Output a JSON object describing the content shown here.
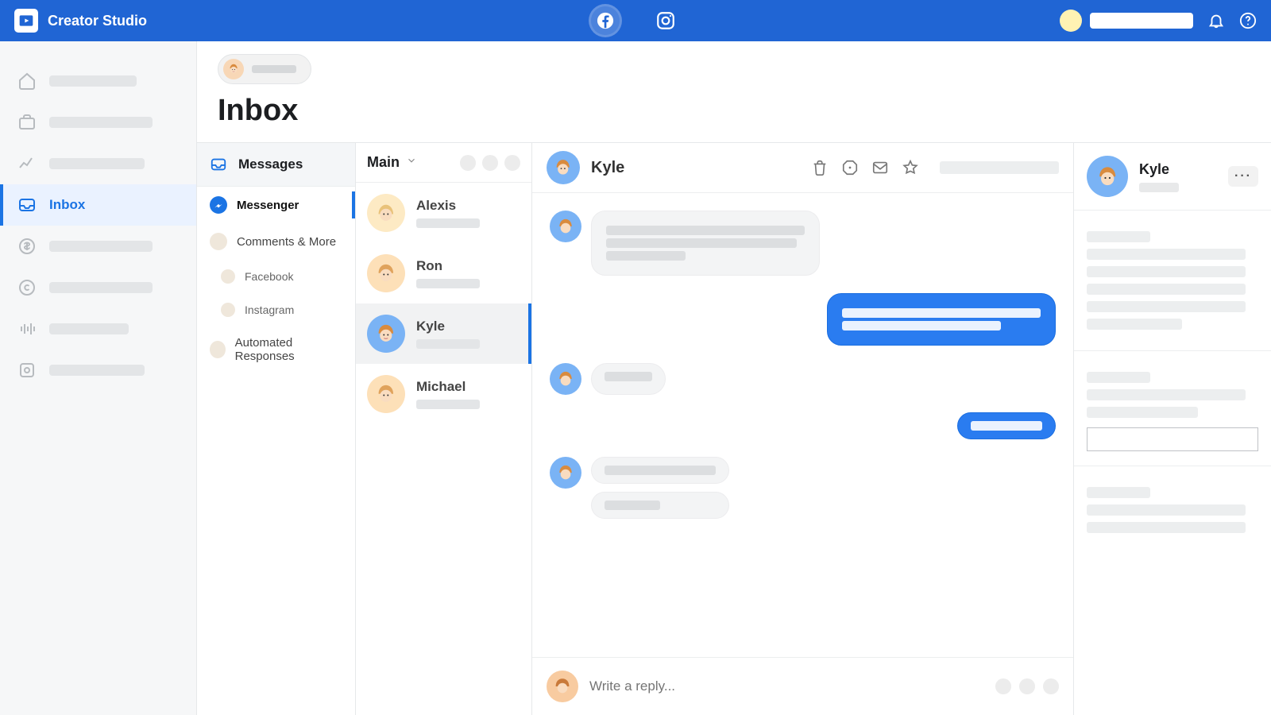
{
  "app": {
    "title": "Creator Studio"
  },
  "sidebar": {
    "active_index": 3,
    "items": [
      {
        "id": "home"
      },
      {
        "id": "library"
      },
      {
        "id": "insights"
      },
      {
        "id": "inbox",
        "label": "Inbox"
      },
      {
        "id": "monetization"
      },
      {
        "id": "rights"
      },
      {
        "id": "sound"
      },
      {
        "id": "settings"
      }
    ]
  },
  "page": {
    "title": "Inbox"
  },
  "inbox_tabs": {
    "section_label": "Messages",
    "items": [
      {
        "label": "Messenger",
        "active": true
      },
      {
        "label": "Comments & More"
      },
      {
        "label": "Facebook",
        "sub": true
      },
      {
        "label": "Instagram",
        "sub": true
      },
      {
        "label": "Automated Responses"
      }
    ]
  },
  "threads": {
    "filter_label": "Main",
    "items": [
      {
        "name": "Alexis",
        "unread": true
      },
      {
        "name": "Ron",
        "unread": true
      },
      {
        "name": "Kyle",
        "unread": true,
        "selected": true
      },
      {
        "name": "Michael",
        "unread": true
      }
    ]
  },
  "conversation": {
    "participant": "Kyle",
    "composer_placeholder": "Write a reply..."
  },
  "info_panel": {
    "name": "Kyle",
    "more_label": "···"
  }
}
